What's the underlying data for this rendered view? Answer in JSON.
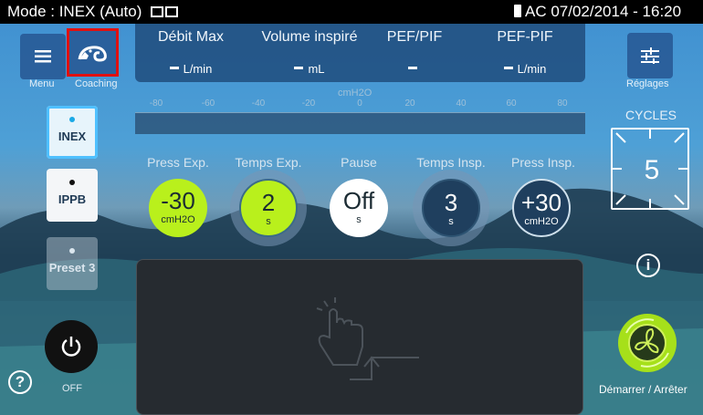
{
  "status_bar": {
    "mode_text": "Mode : INEX (Auto)",
    "right_text": "AC 07/02/2014 - 16:20"
  },
  "left_nav": {
    "menu_label": "Menu",
    "coaching_label": "Coaching"
  },
  "right_nav": {
    "settings_label": "Réglages"
  },
  "measurements": [
    {
      "title": "Débit Max",
      "value": "L/min"
    },
    {
      "title": "Volume inspiré",
      "value": "mL"
    },
    {
      "title": "PEF/PIF",
      "value": ""
    },
    {
      "title": "PEF-PIF",
      "value": "L/min"
    }
  ],
  "gauge": {
    "unit": "cmH2O",
    "ticks": [
      "-80",
      "-60",
      "-40",
      "-20",
      "0",
      "20",
      "40",
      "60",
      "80"
    ]
  },
  "modes": [
    {
      "label": "INEX",
      "state": "active"
    },
    {
      "label": "IPPB",
      "state": "available"
    },
    {
      "label": "Preset 3",
      "state": "disabled"
    }
  ],
  "parameters": [
    {
      "label": "Press Exp.",
      "value": "-30",
      "unit": "cmH2O",
      "color": "#b9f01c"
    },
    {
      "label": "Temps Exp.",
      "value": "2",
      "unit": "s",
      "color": "#b9f01c"
    },
    {
      "label": "Pause",
      "value": "Off",
      "unit": "s",
      "color": "#ffffff"
    },
    {
      "label": "Temps Insp.",
      "value": "3",
      "unit": "s",
      "color": "#1f3f5e"
    },
    {
      "label": "Press Insp.",
      "value": "+30",
      "unit": "cmH2O",
      "color": "#1f3f5e"
    }
  ],
  "cycles": {
    "label": "CYCLES",
    "value": "5"
  },
  "controls": {
    "start_stop_label": "Démarrer / Arrêter",
    "off_label": "OFF"
  },
  "colors": {
    "accent_green": "#a6e01a",
    "panel_blue": "#204c7d",
    "highlight_red": "#e01010"
  }
}
